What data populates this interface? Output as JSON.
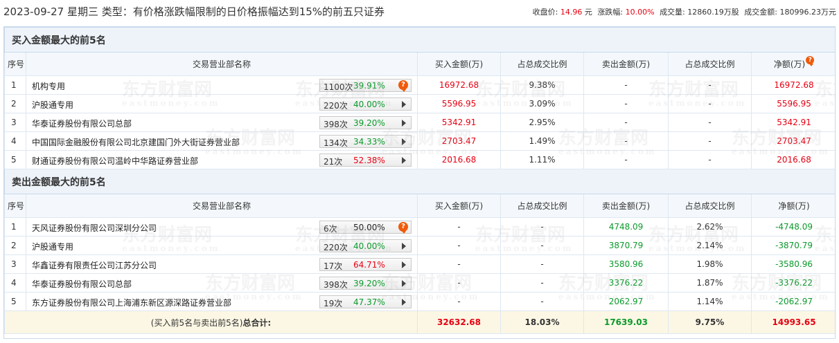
{
  "header": {
    "title": "2023-09-27 星期三 类型：有价格涨跌幅限制的日价格振幅达到15%的前五只证券",
    "close_label": "收盘价:",
    "close_value": "14.96",
    "close_unit": "元",
    "change_label": "涨跌幅:",
    "change_value": "10.00%",
    "volume_label": "成交量:",
    "volume_value": "12860.19万股",
    "turnover_label": "成交金额:",
    "turnover_value": "180996.23万元"
  },
  "watermark": {
    "cn": "东方财富网",
    "en": "eastmoney.com"
  },
  "columns": {
    "idx": "序号",
    "name": "交易营业部名称",
    "buy": "买入金额(万)",
    "buy_ratio": "占总成交比例",
    "sell": "卖出金额(万)",
    "sell_ratio": "占总成交比例",
    "net": "净额(万)"
  },
  "buy_section": {
    "title": "买入金额最大的前5名",
    "rows": [
      {
        "idx": "1",
        "name": "机构专用",
        "count": "1100次",
        "pct": "39.91%",
        "pct_color": "green",
        "btn": "q",
        "buy": "16972.68",
        "buy_ratio": "9.38%",
        "sell": "-",
        "sell_ratio": "-",
        "net": "16972.68"
      },
      {
        "idx": "2",
        "name": "沪股通专用",
        "count": "220次",
        "pct": "40.00%",
        "pct_color": "green",
        "btn": "arrow",
        "buy": "5596.95",
        "buy_ratio": "3.09%",
        "sell": "-",
        "sell_ratio": "-",
        "net": "5596.95"
      },
      {
        "idx": "3",
        "name": "华泰证券股份有限公司总部",
        "count": "398次",
        "pct": "39.20%",
        "pct_color": "green",
        "btn": "arrow",
        "buy": "5342.91",
        "buy_ratio": "2.95%",
        "sell": "-",
        "sell_ratio": "-",
        "net": "5342.91"
      },
      {
        "idx": "4",
        "name": "中国国际金融股份有限公司北京建国门外大街证券营业部",
        "count": "134次",
        "pct": "34.33%",
        "pct_color": "green",
        "btn": "arrow",
        "buy": "2703.47",
        "buy_ratio": "1.49%",
        "sell": "-",
        "sell_ratio": "-",
        "net": "2703.47"
      },
      {
        "idx": "5",
        "name": "财通证券股份有限公司温岭中华路证券营业部",
        "count": "21次",
        "pct": "52.38%",
        "pct_color": "red",
        "btn": "arrow",
        "buy": "2016.68",
        "buy_ratio": "1.11%",
        "sell": "-",
        "sell_ratio": "-",
        "net": "2016.68"
      }
    ]
  },
  "sell_section": {
    "title": "卖出金额最大的前5名",
    "rows": [
      {
        "idx": "1",
        "name": "天风证券股份有限公司深圳分公司",
        "count": "6次",
        "pct": "50.00%",
        "pct_color": "plain",
        "btn": "q",
        "buy": "-",
        "buy_ratio": "-",
        "sell": "4748.09",
        "sell_ratio": "2.62%",
        "net": "-4748.09"
      },
      {
        "idx": "2",
        "name": "沪股通专用",
        "count": "220次",
        "pct": "40.00%",
        "pct_color": "green",
        "btn": "arrow",
        "buy": "-",
        "buy_ratio": "-",
        "sell": "3870.79",
        "sell_ratio": "2.14%",
        "net": "-3870.79"
      },
      {
        "idx": "3",
        "name": "华鑫证券有限责任公司江苏分公司",
        "count": "17次",
        "pct": "64.71%",
        "pct_color": "red",
        "btn": "arrow",
        "buy": "-",
        "buy_ratio": "-",
        "sell": "3580.96",
        "sell_ratio": "1.98%",
        "net": "-3580.96"
      },
      {
        "idx": "4",
        "name": "华泰证券股份有限公司总部",
        "count": "398次",
        "pct": "39.20%",
        "pct_color": "green",
        "btn": "arrow",
        "buy": "-",
        "buy_ratio": "-",
        "sell": "3376.22",
        "sell_ratio": "1.87%",
        "net": "-3376.22"
      },
      {
        "idx": "5",
        "name": "东方证券股份有限公司上海浦东新区源深路证券营业部",
        "count": "19次",
        "pct": "47.37%",
        "pct_color": "green",
        "btn": "arrow",
        "buy": "-",
        "buy_ratio": "-",
        "sell": "2062.97",
        "sell_ratio": "1.14%",
        "net": "-2062.97"
      }
    ]
  },
  "total": {
    "label_prefix": "(买入前5名与卖出前5名)",
    "label_bold": "总合计:",
    "buy": "32632.68",
    "buy_ratio": "18.03%",
    "sell": "17639.03",
    "sell_ratio": "9.75%",
    "net": "14993.65"
  },
  "colors": {
    "up": "#e60012",
    "down": "#0a9a2b",
    "accent": "#f05a0a"
  },
  "icons": {
    "row_button": "play-arrow-icon",
    "note_button": "question-bubble-icon"
  }
}
